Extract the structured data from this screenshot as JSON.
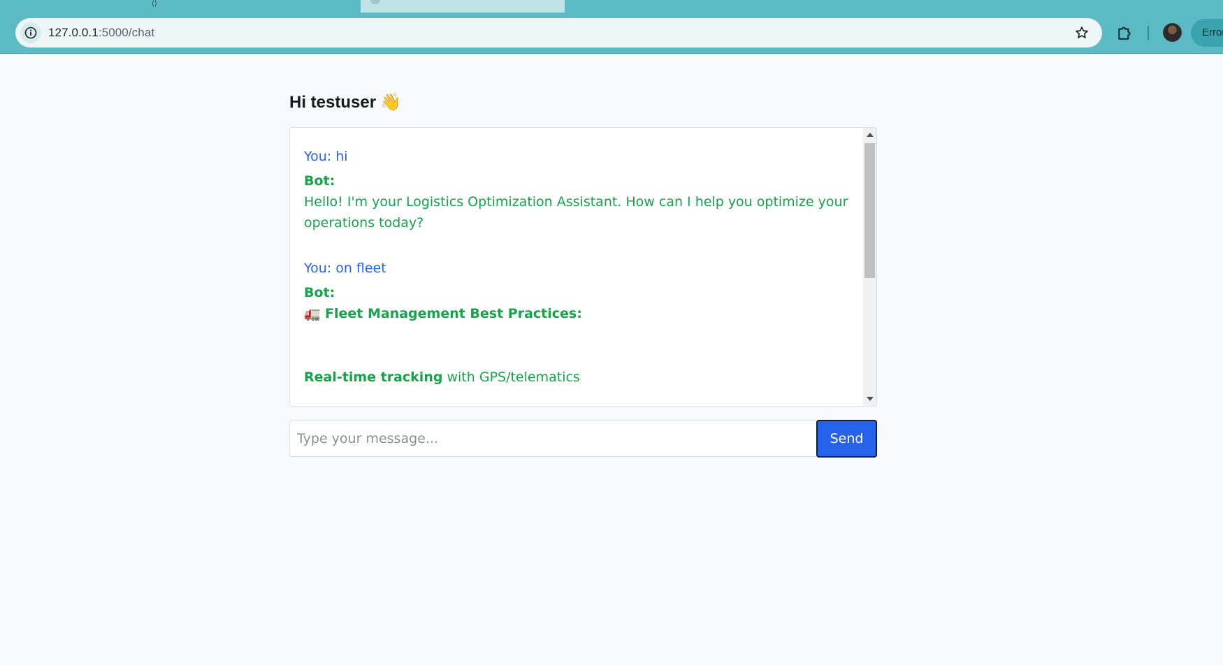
{
  "browser": {
    "url_host": "127.0.0.1",
    "url_path": ":5000/chat",
    "error_label": "Error"
  },
  "page": {
    "greeting": "Hi testuser",
    "greeting_emoji": "👋"
  },
  "chat": {
    "messages": [
      {
        "user": "You: hi"
      },
      {
        "bot_label": "Bot:",
        "bot_text": "Hello! I'm your Logistics Optimization Assistant. How can I help you optimize your operations today?"
      },
      {
        "user": "You: on fleet"
      },
      {
        "bot_label": "Bot:",
        "bot_heading_emoji": "🚛",
        "bot_heading": "Fleet Management Best Practices:",
        "bot_item_bold": "Real-time tracking",
        "bot_item_rest": " with GPS/telematics"
      }
    ]
  },
  "composer": {
    "placeholder": "Type your message...",
    "send_label": "Send"
  },
  "colors": {
    "chrome": "#5bbac4",
    "user_text": "#2563eb",
    "bot_text": "#16a34a",
    "send_button": "#2563eb"
  },
  "icons": {
    "site_info": "info-icon",
    "bookmark": "star-icon",
    "extensions": "puzzle-icon"
  }
}
